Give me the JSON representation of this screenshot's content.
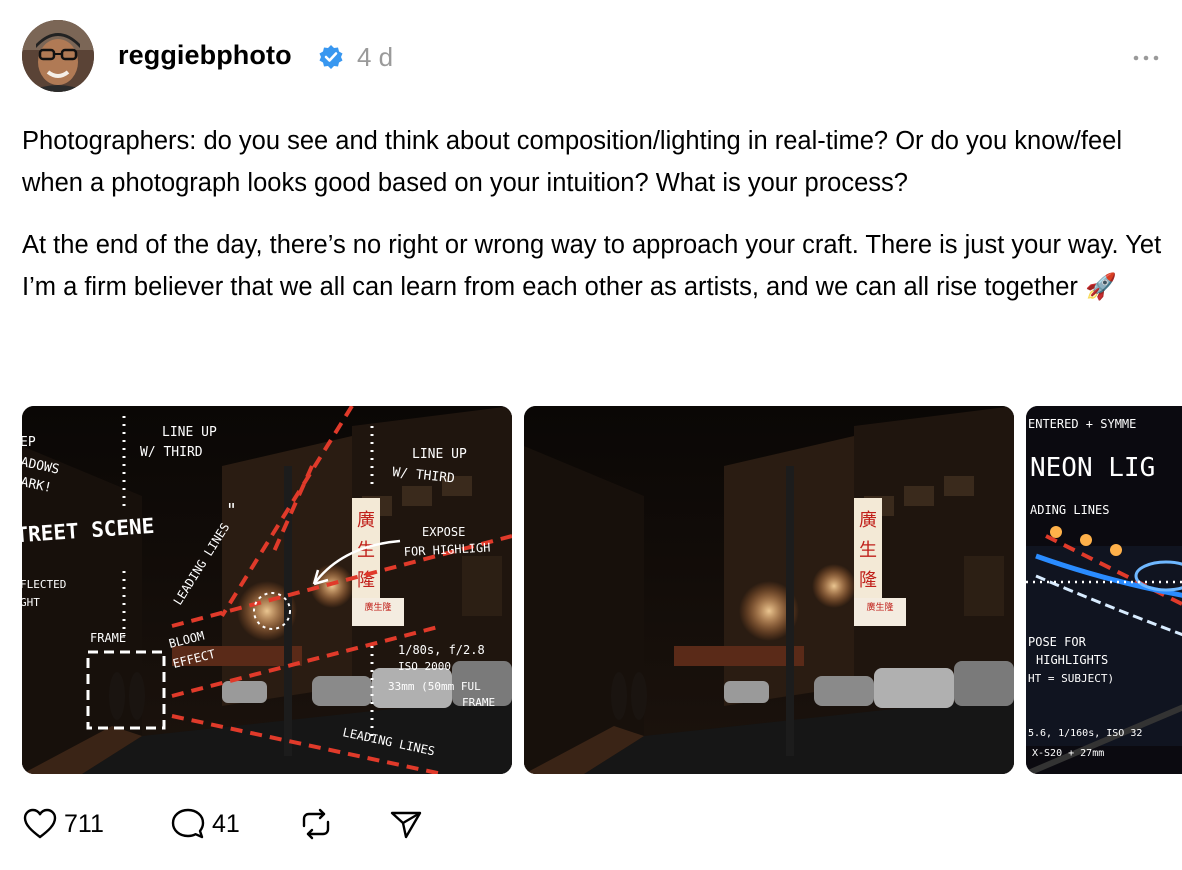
{
  "post": {
    "username": "reggiebphoto",
    "verified": true,
    "timestamp": "4 d",
    "paragraphs": [
      "Photographers: do you see and think about composition/lighting in real-time? Or do you know/feel when a photograph looks good based on your intuition? What is your process?",
      "At the end of the day, there’s no right or wrong way to approach your craft. There is just your way. Yet I’m a firm believer that we all can learn from each other as artists, and we can all rise together 🚀"
    ]
  },
  "photo1": {
    "notes": {
      "p1_dark_1": "EP",
      "p1_dark_2": "ADOWS",
      "p1_dark_3": "ARK!",
      "p1_lineup_1a": "LINE UP",
      "p1_lineup_1b": "W/ THIRD",
      "p1_lineup_2a": "LINE UP",
      "p1_lineup_2b": "W/ THIRD",
      "p1_street": "TREET SCENE",
      "p1_quote": "\"",
      "p1_leading_1": "LEADING LINES",
      "p1_expose_1": "EXPOSE",
      "p1_expose_2": "FOR HIGHLIGH",
      "p1_reflected_1": "FLECTED",
      "p1_reflected_2": "GHT",
      "p1_frame": "FRAME",
      "p1_bloom_1": "BLOOM",
      "p1_bloom_2": "EFFECT",
      "p1_settings_1": "1/80s, f/2.8",
      "p1_settings_2": "ISO 2000",
      "p1_settings_3": "33mm (50mm FUL",
      "p1_settings_4": "FRAME",
      "p1_leading_2": "LEADING LINES"
    }
  },
  "photo3": {
    "notes": {
      "p3_centered": "ENTERED + SYMME",
      "p3_neon": "NEON LIG",
      "p3_leading": "ADING LINES",
      "p3_expose_1": "POSE FOR",
      "p3_expose_2": "HIGHLIGHTS",
      "p3_expose_3": "HT = SUBJECT)",
      "p3_settings_1": "5.6, 1/160s, ISO 32",
      "p3_settings_2": "X-S20 + 27mm"
    }
  },
  "sign": {
    "chars": [
      "廣",
      "生",
      "隆"
    ],
    "plate": "廣生隆"
  },
  "actions": {
    "likes": "711",
    "replies": "41"
  },
  "colors": {
    "verified_blue": "#3897f0",
    "timestamp_gray": "#9a9a9a",
    "annotation_red": "#e03a2a"
  },
  "icons": {
    "like": "heart-icon",
    "reply": "speech-bubble-icon",
    "repost": "repost-arrows-icon",
    "share": "paper-plane-icon",
    "more": "ellipsis-icon",
    "verified": "verified-badge-icon"
  }
}
